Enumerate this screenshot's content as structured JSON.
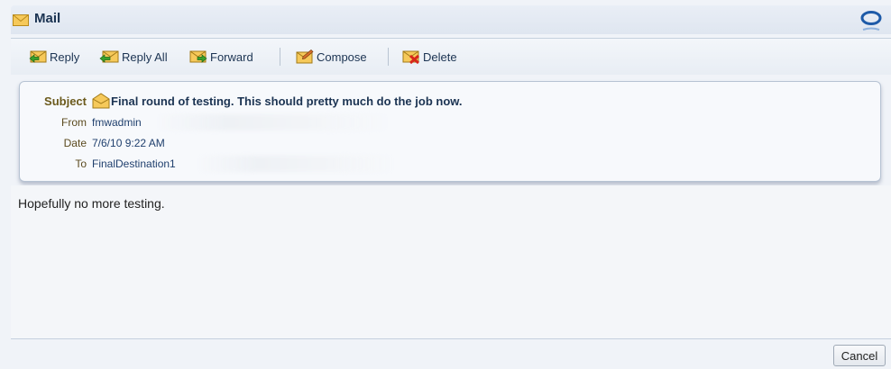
{
  "window": {
    "title": "Mail",
    "icon": "envelope-icon",
    "brand_icon": "oracle-logo-icon"
  },
  "toolbar": {
    "reply": "Reply",
    "reply_all": "Reply All",
    "forward": "Forward",
    "compose": "Compose",
    "delete": "Delete"
  },
  "header": {
    "subject_label": "Subject",
    "subject": "Final round of testing. This should pretty much do the job now.",
    "from_label": "From",
    "from": "fmwadmin",
    "date_label": "Date",
    "date": "7/6/10 9:22 AM",
    "to_label": "To",
    "to": "FinalDestination1"
  },
  "body": {
    "text": "Hopefully no more testing."
  },
  "footer": {
    "cancel": "Cancel"
  },
  "colors": {
    "accent": "#1b3352",
    "label": "#6b5a1c",
    "panel_border": "#b7c3d3"
  }
}
